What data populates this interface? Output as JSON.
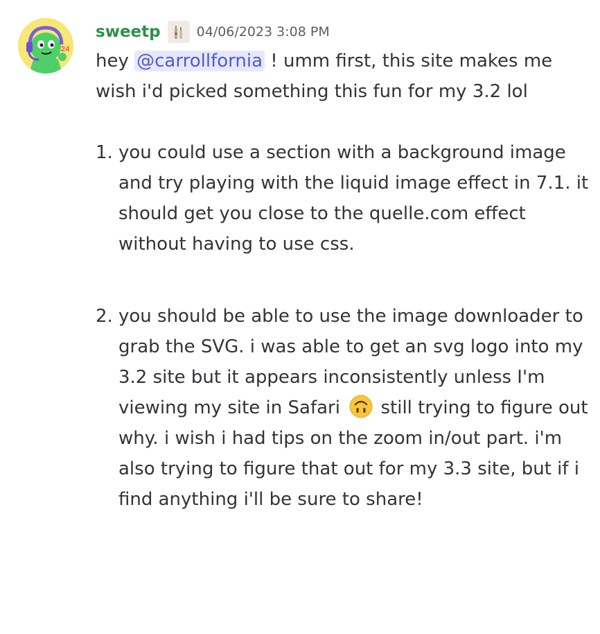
{
  "message": {
    "author": "sweetp",
    "timestamp": "04/06/2023 3:08 PM",
    "intro_before": "hey ",
    "mention": "@carrollfornia",
    "intro_after": " !  umm first, this site makes me wish i'd picked something this fun for my 3.2 lol",
    "items": [
      {
        "number": "1.",
        "text": "you could use a section with a background image and try playing with the liquid image effect in 7.1. it should get you close to the quelle.com effect without having to use css."
      },
      {
        "number": "2.",
        "text_before_emoji": "you should be able to use the image downloader to grab the SVG. i was able to get an svg logo into my 3.2 site but it appears inconsistently unless I'm viewing my site in Safari ",
        "text_after_emoji": " still trying to figure out why. i wish i had tips on the zoom in/out part. i'm also trying to figure that out for my 3.3 site, but if i find anything i'll be sure to share!"
      }
    ],
    "emoji_icon": "upside-down-face-icon",
    "avatar_icon": "green-character-with-headset-icon"
  },
  "colors": {
    "username": "#2f8f4e",
    "mention_text": "#4e5bd6",
    "mention_bg": "#e6e8fd",
    "timestamp": "#5c5e66",
    "body_text": "#313338"
  }
}
